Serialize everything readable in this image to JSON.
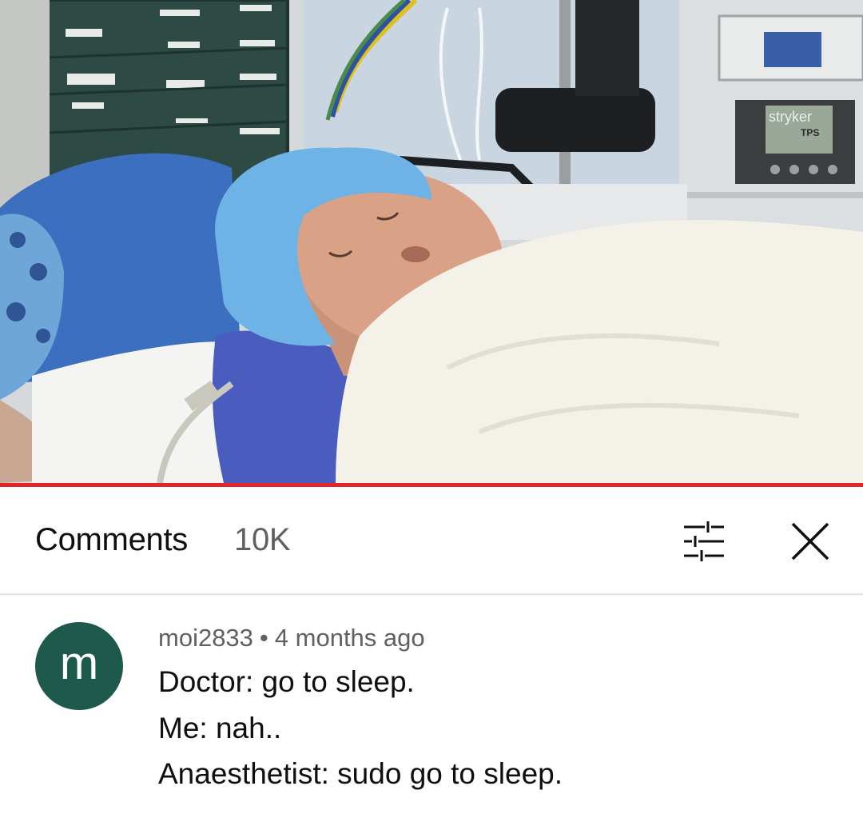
{
  "video": {
    "frame_description_icon": "video-frame",
    "equipment_brand_text": "stryker",
    "equipment_model_text": "TPS",
    "progress_color": "#e32525",
    "progress_fraction": 1.0
  },
  "comments_panel": {
    "title": "Comments",
    "count": "10K",
    "filter_icon": "sort-filter-icon",
    "close_icon": "close-icon"
  },
  "comment": {
    "avatar_letter": "m",
    "avatar_color": "#1e5a4c",
    "author": "moi2833",
    "separator": "•",
    "time": "4 months ago",
    "lines": [
      "Doctor: go to sleep.",
      "Me: nah..",
      "Anaesthetist: sudo go to sleep."
    ]
  }
}
